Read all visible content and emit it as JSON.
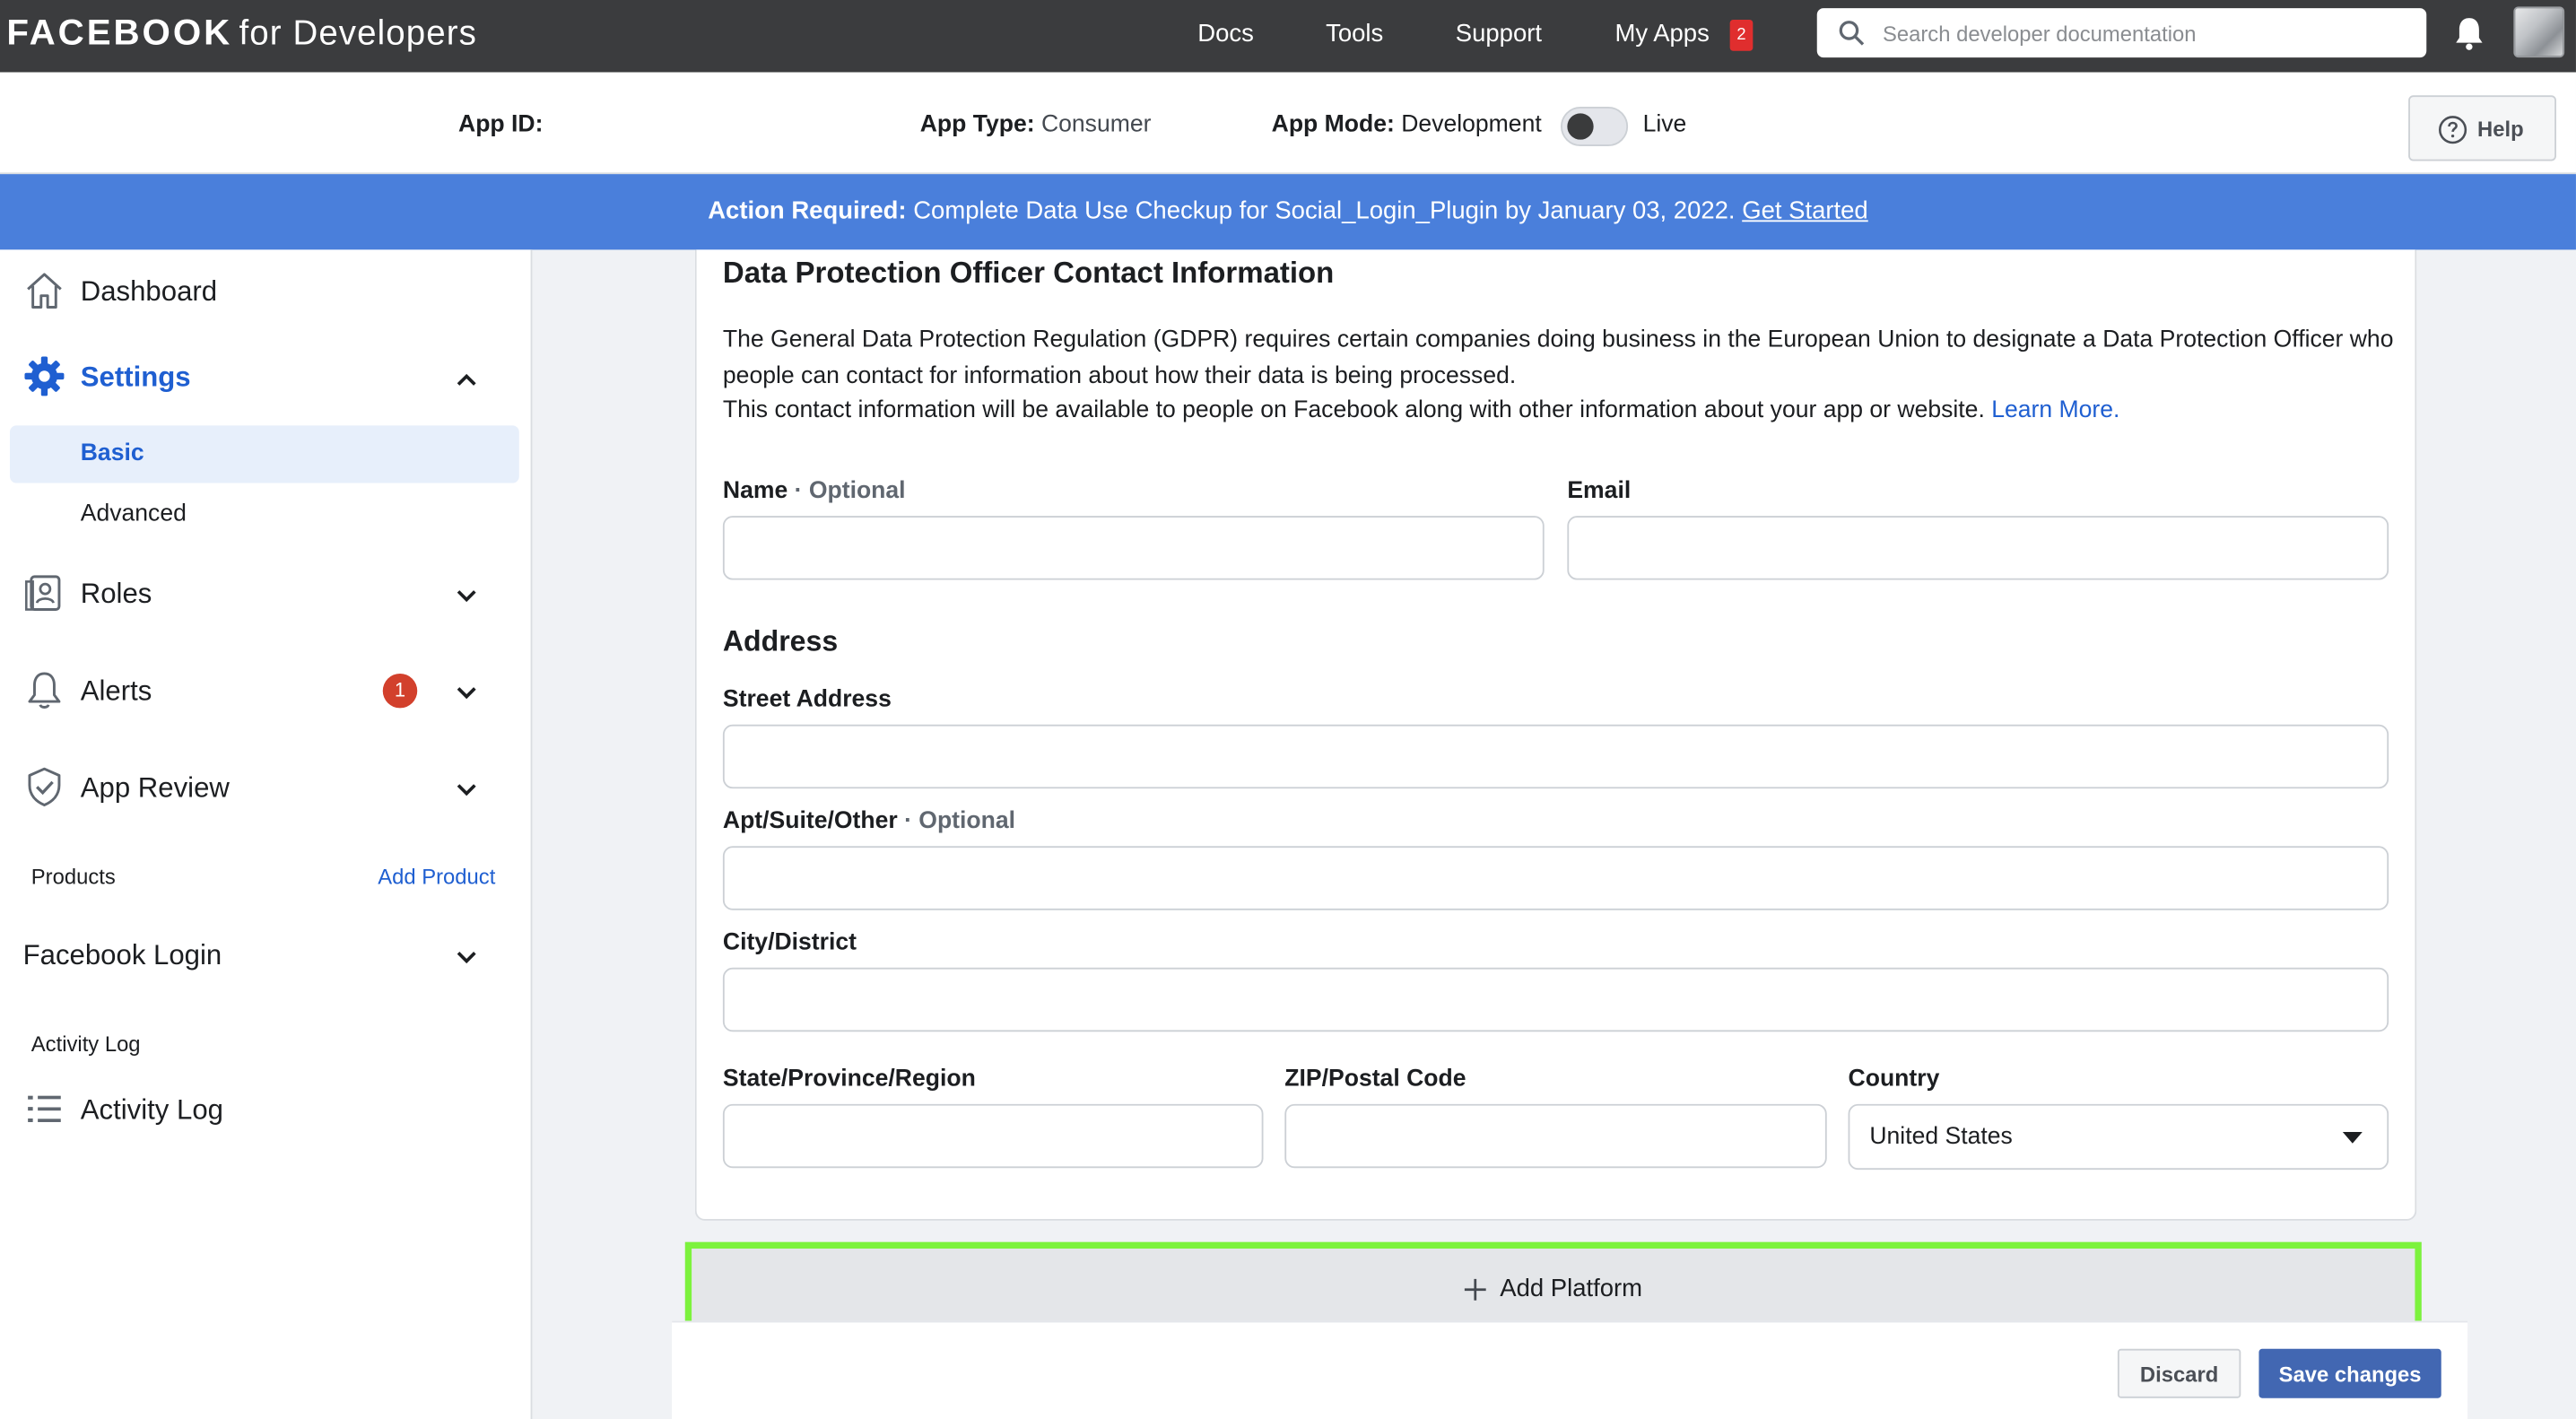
{
  "topbar": {
    "logo_main": "FACEBOOK",
    "logo_sub": "for Developers",
    "nav": {
      "docs": "Docs",
      "tools": "Tools",
      "support": "Support",
      "my_apps": "My Apps",
      "my_apps_badge": "2"
    },
    "search_placeholder": "Search developer documentation",
    "icons": [
      "search-icon",
      "bell-icon",
      "avatar"
    ]
  },
  "appbar": {
    "app_id_label": "App ID:",
    "app_type_label": "App Type:",
    "app_type_value": "Consumer",
    "app_mode_label": "App Mode:",
    "app_mode_value": "Development",
    "live_label": "Live",
    "help_label": "Help"
  },
  "banner": {
    "prefix": "Action Required:",
    "text": "Complete Data Use Checkup for Social_Login_Plugin by January 03, 2022.",
    "link": "Get Started",
    "color": "#4a7fdb"
  },
  "sidebar": {
    "dashboard": "Dashboard",
    "settings": "Settings",
    "basic": "Basic",
    "advanced": "Advanced",
    "roles": "Roles",
    "alerts": "Alerts",
    "alerts_badge": "1",
    "app_review": "App Review",
    "products_header": "Products",
    "add_product": "Add Product",
    "facebook_login": "Facebook Login",
    "activity_header": "Activity Log",
    "activity_log": "Activity Log",
    "accent": "#1f5fd1"
  },
  "form": {
    "title": "Data Protection Officer Contact Information",
    "desc_line1": "The General Data Protection Regulation (GDPR) requires certain companies doing business in the European Union to designate a Data Protection Officer who people can contact for information about how their data is being processed.",
    "desc_line2": "This contact information will be available to people on Facebook along with other information about your app or website.",
    "learn_more": "Learn More.",
    "name_label": "Name",
    "optional": "· Optional",
    "email_label": "Email",
    "address_heading": "Address",
    "street_label": "Street Address",
    "apt_label": "Apt/Suite/Other",
    "city_label": "City/District",
    "state_label": "State/Province/Region",
    "zip_label": "ZIP/Postal Code",
    "country_label": "Country",
    "country_value": "United States",
    "values": {
      "name": "",
      "email": "",
      "street": "",
      "apt": "",
      "city": "",
      "state": "",
      "zip": ""
    }
  },
  "add_platform": {
    "label": "Add Platform",
    "highlight_color": "#7cf23d"
  },
  "footer": {
    "discard": "Discard",
    "save": "Save changes"
  }
}
